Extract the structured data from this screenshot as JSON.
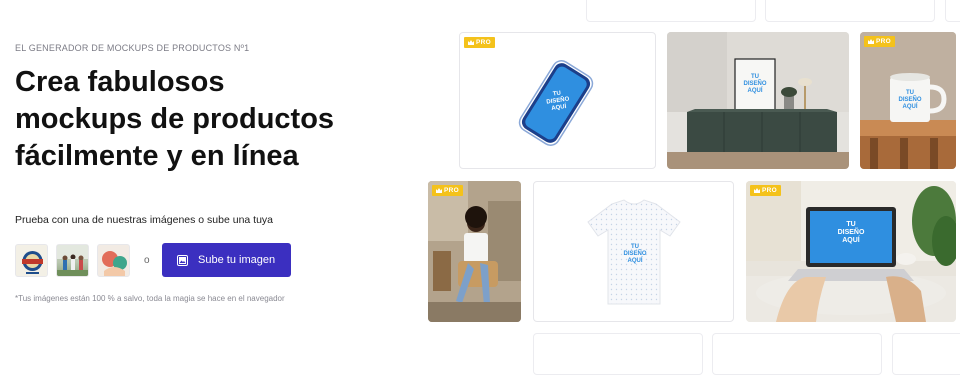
{
  "hero": {
    "eyebrow": "EL GENERADOR DE MOCKUPS DE PRODUCTOS Nº1",
    "title_lines": [
      "Crea fabulosos",
      "mockups de productos",
      "fácilmente y en línea"
    ],
    "prompt": "Prueba con una de nuestras imágenes o sube una tuya",
    "or_label": "o",
    "upload_label": "Sube tu imagen",
    "footnote": "*Tus imágenes están 100 % a salvo, toda la magia se hace en el navegador"
  },
  "sample_thumbs": [
    {
      "name": "beer-label-thumb"
    },
    {
      "name": "group-photo-thumb"
    },
    {
      "name": "hands-illustration-thumb"
    }
  ],
  "gallery": {
    "pro_label": "PRO",
    "design_placeholder": "TU\nDISEÑO\nAQUÍ",
    "cards": [
      {
        "name": "phone-mockup-card",
        "pro": true
      },
      {
        "name": "frame-sideboard-card",
        "pro": false
      },
      {
        "name": "mug-mockup-card",
        "pro": true
      },
      {
        "name": "tshirt-model-card",
        "pro": true
      },
      {
        "name": "tshirt-flat-card",
        "pro": false
      },
      {
        "name": "laptop-mockup-card",
        "pro": true
      }
    ]
  },
  "colors": {
    "accent": "#3b2fc0",
    "pro_badge": "#f4c21b",
    "design_blue": "#2f8fe0"
  }
}
